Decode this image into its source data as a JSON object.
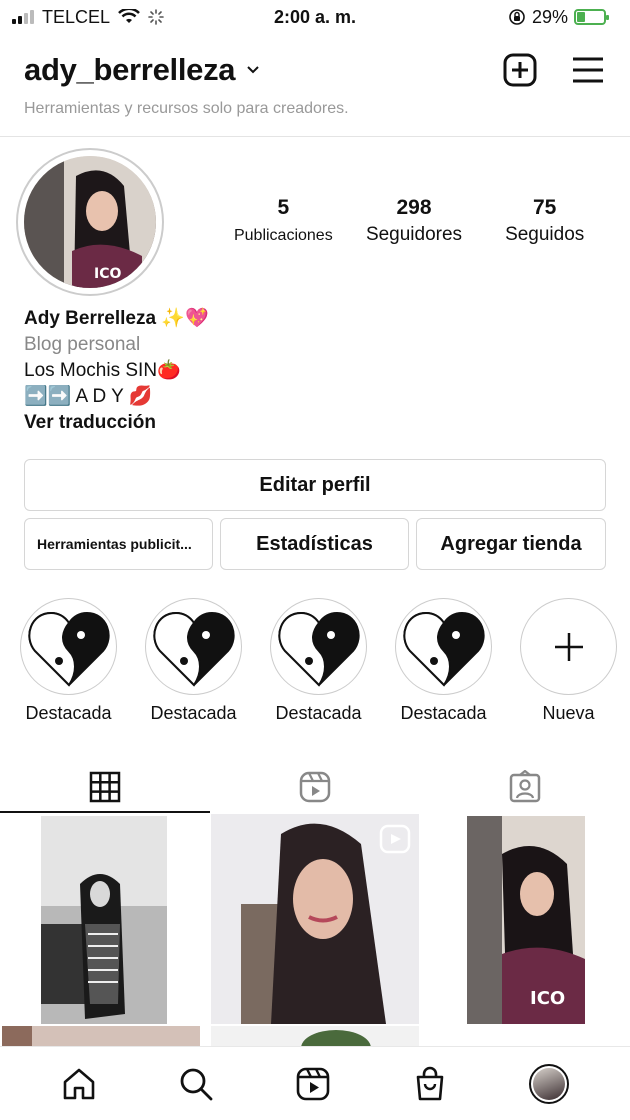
{
  "status_bar": {
    "carrier": "TELCEL",
    "time": "2:00 a. m.",
    "battery_percent": "29%",
    "battery_level": 0.29
  },
  "header": {
    "username": "ady_berrelleza",
    "creator_tools_text": "Herramientas y recursos solo para creadores."
  },
  "profile": {
    "stats": [
      {
        "value": "5",
        "label": "Publicaciones"
      },
      {
        "value": "298",
        "label": "Seguidores"
      },
      {
        "value": "75",
        "label": "Seguidos"
      }
    ],
    "bio": {
      "name": "Ady Berrelleza ✨💖",
      "category": "Blog personal",
      "line1": "Los Mochis SIN🍅",
      "line2": "➡️➡️ A D Y 💋",
      "translate": "Ver traducción"
    }
  },
  "buttons": {
    "edit_profile": "Editar perfil",
    "ad_tools": "Herramientas publicit...",
    "stats": "Estadísticas",
    "add_shop": "Agregar tienda"
  },
  "highlights": [
    {
      "label": "Destacada"
    },
    {
      "label": "Destacada"
    },
    {
      "label": "Destacada"
    },
    {
      "label": "Destacada"
    },
    {
      "label": "Nueva"
    }
  ],
  "tabs": [
    {
      "icon": "grid-icon",
      "active": true
    },
    {
      "icon": "reels-icon",
      "active": false
    },
    {
      "icon": "tagged-icon",
      "active": false
    }
  ],
  "bottom_nav": [
    "home-icon",
    "search-icon",
    "reels-icon",
    "shop-icon",
    "profile-avatar"
  ]
}
